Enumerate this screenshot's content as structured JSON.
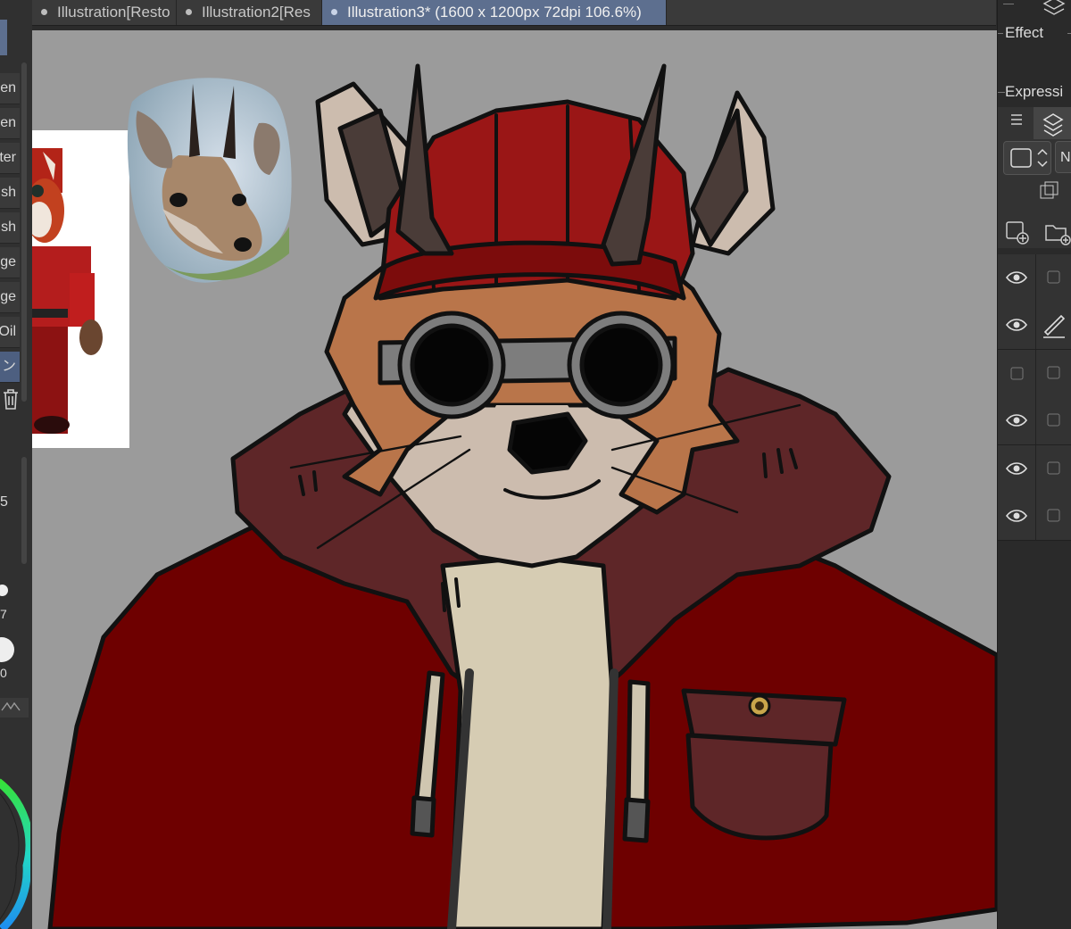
{
  "tabs": [
    {
      "label": "Illustration[Resto"
    },
    {
      "label": "Illustration2[Res"
    },
    {
      "label": "Illustration3* (1600 x 1200px 72dpi 106.6%)",
      "active": true
    }
  ],
  "left_panel": {
    "brushes": [
      {
        "label": "en"
      },
      {
        "label": "en"
      },
      {
        "label": "ter"
      },
      {
        "label": "sh"
      },
      {
        "label": "sh"
      },
      {
        "label": "ge"
      },
      {
        "label": "ge"
      },
      {
        "label": "Oil"
      },
      {
        "label": "ン",
        "selected": true
      }
    ],
    "size_values": [
      "5",
      "7",
      "0"
    ]
  },
  "right_panel": {
    "sections": [
      {
        "label": "Effect"
      },
      {
        "label": "Expressi"
      }
    ],
    "layers": [
      {
        "visible": true
      },
      {
        "visible": true,
        "editing": true
      },
      {
        "visible": false
      },
      {
        "visible": true
      },
      {
        "visible": true
      },
      {
        "visible": true
      }
    ]
  },
  "colors": {
    "tab_active": "#5d6f8f",
    "canvas_gray": "#9b9b9b",
    "jacket_red": "#6e0000",
    "fur_collar": "#5e2628",
    "hat_red": "#9a1616",
    "fur_orange": "#b9754a",
    "fur_cream": "#ccbcae",
    "shirt_cream": "#d6ccb3"
  }
}
